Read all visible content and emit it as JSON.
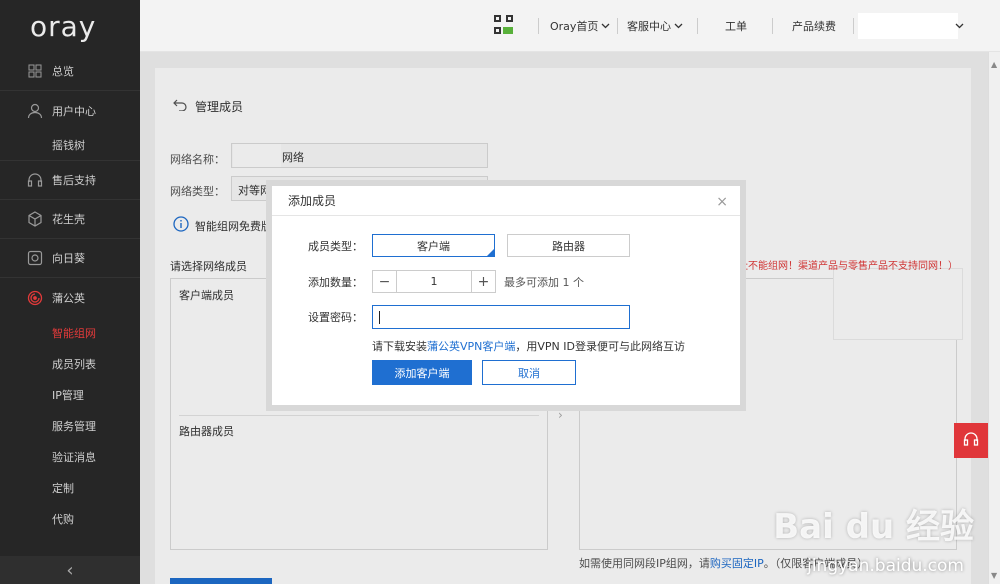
{
  "logo": "oray",
  "sidebar": {
    "items": [
      {
        "label": "总览",
        "icon": "grid-icon"
      },
      {
        "label": "用户中心",
        "icon": "user-icon"
      },
      {
        "label": "摇钱树",
        "icon": ""
      },
      {
        "label": "售后支持",
        "icon": "headset-icon"
      },
      {
        "label": "花生壳",
        "icon": "cube-icon"
      },
      {
        "label": "向日葵",
        "icon": "sun-icon"
      },
      {
        "label": "蒲公英",
        "icon": "dandelion-icon"
      },
      {
        "label": "智能组网",
        "icon": ""
      },
      {
        "label": "成员列表",
        "icon": ""
      },
      {
        "label": "IP管理",
        "icon": ""
      },
      {
        "label": "服务管理",
        "icon": ""
      },
      {
        "label": "验证消息",
        "icon": ""
      },
      {
        "label": "定制",
        "icon": ""
      },
      {
        "label": "代购",
        "icon": ""
      }
    ],
    "collapse_glyph": "‹"
  },
  "topbar": {
    "qr_icon": "qrcode-icon",
    "home": "Oray首页",
    "service": "客服中心",
    "ticket": "工单",
    "renew": "产品续费"
  },
  "page": {
    "back_title": "管理成员",
    "network_name_label": "网络名称：",
    "network_name_suffix": "网络",
    "network_type_label": "网络类型：",
    "network_type_value": "对等网",
    "info_text": "智能组网免费版",
    "select_members_label": "请选择网络成员",
    "client_members": "客户端成员",
    "router_members": "路由器成员",
    "warning": "址不能组网！渠道产品与零售产品不支持同网！）",
    "bottom_note_prefix": "如需使用同网段IP组网，请",
    "bottom_note_link": "购买固定IP",
    "bottom_note_suffix": "。（仅限客户端成员）"
  },
  "modal": {
    "title": "添加成员",
    "close": "×",
    "member_type_label": "成员类型：",
    "type_client": "客户端",
    "type_router": "路由器",
    "quantity_label": "添加数量：",
    "minus": "−",
    "quantity": "1",
    "plus": "+",
    "max_hint": "最多可添加 1 个",
    "password_label": "设置密码：",
    "password_value": "",
    "hint_prefix": "请下载安装",
    "hint_link": "蒲公英VPN客户端",
    "hint_suffix": "，用VPN ID登录便可与此网络互访",
    "confirm": "添加客户端",
    "cancel": "取消"
  },
  "watermark": {
    "brand": "Bai du 经验",
    "url": "jingyan.baidu.com"
  },
  "colors": {
    "sidebar_bg": "#262626",
    "accent": "#1f6fd1",
    "danger": "#e23a3a"
  }
}
